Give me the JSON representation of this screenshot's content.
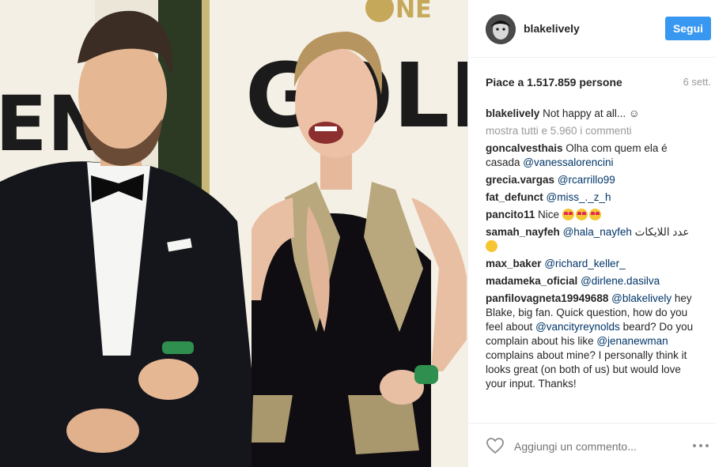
{
  "photo": {
    "backdrop_text": [
      "EN",
      "GOLD",
      "NE"
    ]
  },
  "header": {
    "username": "blakelively",
    "follow_label": "Segui"
  },
  "likes": {
    "text": "Piace a 1.517.859 persone",
    "date": "6 sett."
  },
  "caption": {
    "user": "blakelively",
    "text": " Not happy at all... ☺"
  },
  "show_all": "mostra tutti e 5.960 i commenti",
  "comments": [
    {
      "user": "goncalvesthais",
      "text": " Olha com quem ela é casada ",
      "mention": "@vanessalorencini"
    },
    {
      "user": "grecia.vargas",
      "text": " ",
      "mention": "@rcarrillo99"
    },
    {
      "user": "fat_defunct",
      "text": " ",
      "mention": "@miss_._z_h"
    },
    {
      "user": "pancito11",
      "text": " Nice "
    },
    {
      "user": "samah_nayfeh",
      "text": " ",
      "mention": "@hala_nayfeh",
      "text_after": " عدد اللايكات"
    },
    {
      "user": "max_baker",
      "text": " ",
      "mention": "@richard_keller_"
    },
    {
      "user": "madameka_oficial",
      "text": " ",
      "mention": "@dirlene.dasilva"
    },
    {
      "user": "panfilovagneta19949688",
      "mention": "@blakelively",
      "p1": " hey Blake, big fan. Quick question, how do you feel about ",
      "mention2": "@vancityreynolds",
      "p2": " beard? Do you complain about his like ",
      "mention3": "@jenanewman",
      "p3": " complains about mine? I personally think it looks great (on both of us) but would love your input. Thanks!"
    }
  ],
  "footer": {
    "comment_placeholder": "Aggiungi un commento..."
  },
  "icons": {
    "like": "heart-outline-icon",
    "more": "ellipsis-icon"
  },
  "colors": {
    "follow_button": "#3897f0",
    "mention": "#003569",
    "muted": "#999999"
  }
}
